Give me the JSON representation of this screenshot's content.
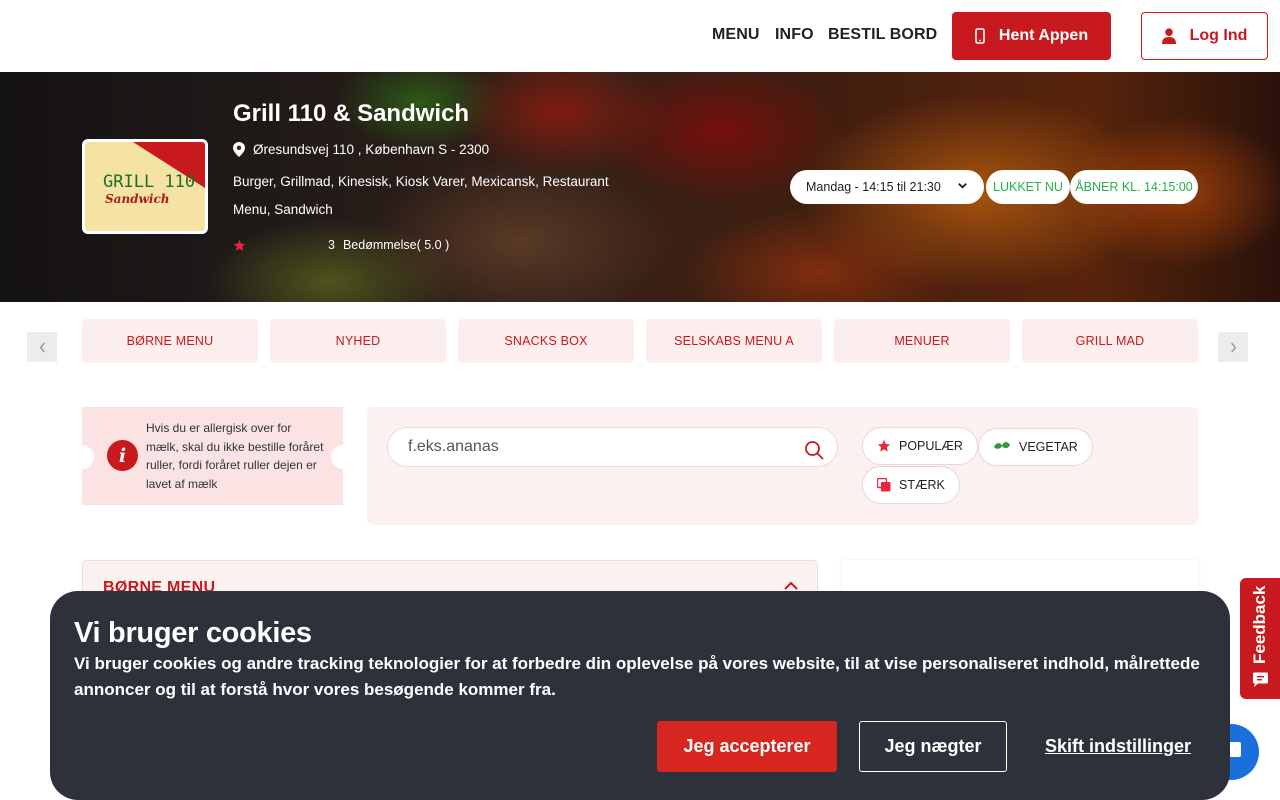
{
  "header": {
    "nav": [
      "MENU",
      "INFO",
      "BESTIL BORD"
    ],
    "app_button": "Hent Appen",
    "login_button": "Log Ind",
    "accent_color": "#c8191e"
  },
  "restaurant": {
    "logo_line1": "GRILL 110",
    "logo_line2": "Sandwich",
    "name": "Grill 110 & Sandwich",
    "address": "Øresundsvej 110 , København S - 2300",
    "categories": "Burger, Grillmad, Kinesisk, Kiosk Varer, Mexicansk, Restaurant Menu, Sandwich",
    "rating_count": "3",
    "rating_text": "Bedømmelse( 5.0 )",
    "hours": "Mandag - 14:15 til 21:30",
    "status_closed": "LUKKET NU",
    "opens_at": "ÅBNER KL. 14:15:00",
    "status_color": "#22b14c"
  },
  "category_tabs": [
    "BØRNE MENU",
    "NYHED",
    "SNACKS BOX",
    "SELSKABS MENU A",
    "MENUER",
    "GRILL MAD"
  ],
  "allergy_notice": "Hvis du er allergisk over for mælk, skal du ikke bestille foråret ruller, fordi foråret ruller dejen er lavet af mælk",
  "search": {
    "placeholder": "f.eks.ananas"
  },
  "filters": {
    "popular": "POPULÆR",
    "vegetarian": "VEGETAR",
    "strong": "STÆRK"
  },
  "menu_section": {
    "title": "BØRNE MENU"
  },
  "feedback_label": "Feedback",
  "cookie": {
    "title": "Vi bruger cookies",
    "text": "Vi bruger cookies og andre tracking teknologier for at forbedre din oplevelse på vores website, til at vise personaliseret indhold, målrettede annoncer og til at forstå hvor vores besøgende kommer fra.",
    "accept": "Jeg accepterer",
    "deny": "Jeg nægter",
    "settings": "Skift indstillinger"
  }
}
